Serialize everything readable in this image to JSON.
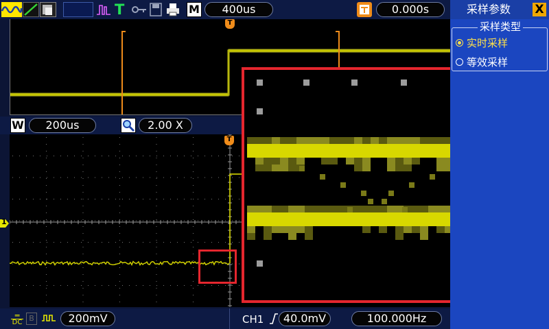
{
  "toolbar": {
    "icons": [
      "waveform-mode-icon",
      "vector-display-icon",
      "persistence-icon",
      "blank-slot-icon",
      "math-pulse-icon",
      "trigger-t-icon",
      "key-icon",
      "save-icon",
      "print-icon"
    ],
    "menu_key": "M",
    "timebase": "400us",
    "trigger_key": "T",
    "trigger_position": "0.000s"
  },
  "panel": {
    "title": "采样参数",
    "close_label": "X",
    "group_label": "采样类型",
    "options": [
      {
        "label": "实时采样",
        "selected": true
      },
      {
        "label": "等效采样",
        "selected": false
      }
    ]
  },
  "window": {
    "w_key": "W",
    "window_timebase": "200us",
    "zoom_factor": "2.00 X"
  },
  "channel_marker": "1",
  "trigger_marker": "T",
  "bottom": {
    "coupling": "DC",
    "volts_per_div": "200mV",
    "trigger_channel": "CH1",
    "trigger_level": "40.0mV",
    "frequency": "100.000Hz"
  },
  "colors": {
    "trace": "#e6e600",
    "trigger_marker": "#f08c1a",
    "zoom_frame": "#e5262e",
    "panel": "#1b46c0"
  }
}
